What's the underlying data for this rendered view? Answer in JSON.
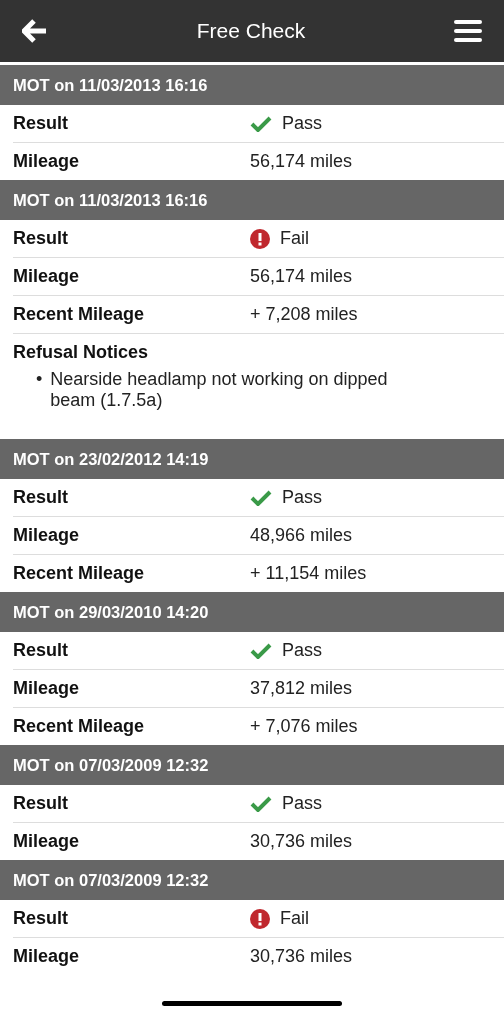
{
  "header": {
    "title": "Free Check"
  },
  "sections": [
    {
      "title": "MOT on 11/03/2013 16:16",
      "rows": [
        {
          "kind": "result",
          "label": "Result",
          "passed": true,
          "value": "Pass"
        },
        {
          "kind": "text",
          "label": "Mileage",
          "value": "56,174 miles"
        }
      ]
    },
    {
      "title": "MOT on 11/03/2013 16:16",
      "rows": [
        {
          "kind": "result",
          "label": "Result",
          "passed": false,
          "value": "Fail"
        },
        {
          "kind": "text",
          "label": "Mileage",
          "value": "56,174 miles"
        },
        {
          "kind": "text",
          "label": "Recent Mileage",
          "value": "+ 7,208 miles"
        },
        {
          "kind": "notices",
          "label": "Refusal Notices",
          "items": [
            {
              "bullet": "•",
              "text": "Nearside headlamp not working on dipped beam (1.7.5a)"
            }
          ]
        }
      ]
    },
    {
      "title": "MOT on 23/02/2012 14:19",
      "rows": [
        {
          "kind": "result",
          "label": "Result",
          "passed": true,
          "value": "Pass"
        },
        {
          "kind": "text",
          "label": "Mileage",
          "value": "48,966 miles"
        },
        {
          "kind": "text",
          "label": "Recent Mileage",
          "value": "+ 11,154 miles"
        }
      ]
    },
    {
      "title": "MOT on 29/03/2010 14:20",
      "rows": [
        {
          "kind": "result",
          "label": "Result",
          "passed": true,
          "value": "Pass"
        },
        {
          "kind": "text",
          "label": "Mileage",
          "value": "37,812 miles"
        },
        {
          "kind": "text",
          "label": "Recent Mileage",
          "value": "+ 7,076 miles"
        }
      ]
    },
    {
      "title": "MOT on 07/03/2009 12:32",
      "rows": [
        {
          "kind": "result",
          "label": "Result",
          "passed": true,
          "value": "Pass"
        },
        {
          "kind": "text",
          "label": "Mileage",
          "value": "30,736 miles"
        }
      ]
    },
    {
      "title": "MOT on 07/03/2009 12:32",
      "rows": [
        {
          "kind": "result",
          "label": "Result",
          "passed": false,
          "value": "Fail"
        },
        {
          "kind": "text",
          "label": "Mileage",
          "value": "30,736 miles"
        }
      ]
    }
  ]
}
